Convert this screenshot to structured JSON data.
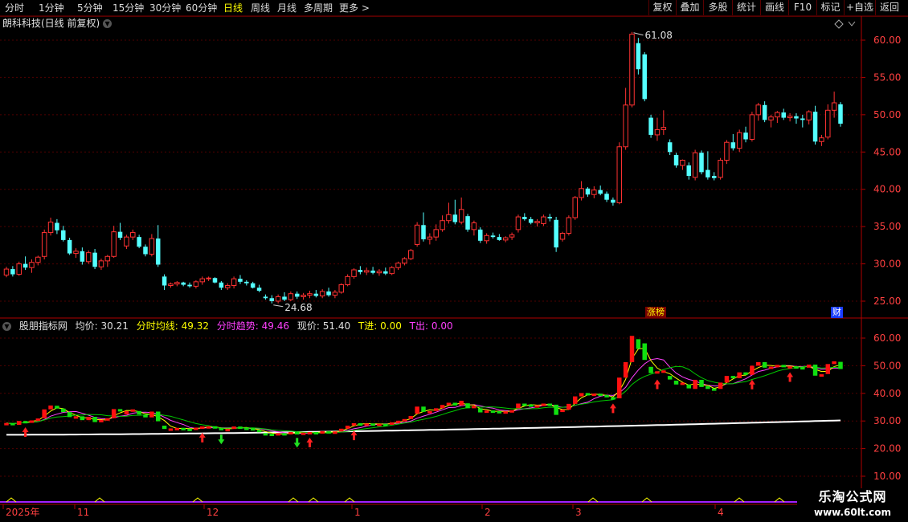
{
  "toolbar": {
    "periods": [
      "分时",
      "1分钟",
      "5分钟",
      "15分钟",
      "30分钟",
      "60分钟",
      "日线",
      "周线",
      "月线",
      "多周期",
      "更多 >"
    ],
    "active_period": "日线",
    "right_buttons": [
      "复权",
      "叠加",
      "多股",
      "统计",
      "画线",
      "F10",
      "标记",
      "+自选",
      "返回"
    ]
  },
  "main_chart": {
    "title": "朗科科技(日线 前复权)",
    "y_ticks": [
      "60.00",
      "55.00",
      "50.00",
      "45.00",
      "40.00",
      "35.00",
      "30.00",
      "25.00"
    ],
    "high_label": "61.08",
    "low_label": "24.68",
    "tags": [
      "涨榜",
      "财"
    ],
    "colors": {
      "up": "#ff3232",
      "down": "#54ffff",
      "axis": "#b00000",
      "grid": "#500000"
    }
  },
  "indicator": {
    "name": "股朋指标网",
    "fields": [
      {
        "label": "均价:",
        "value": "30.21",
        "color": "#e0e0e0"
      },
      {
        "label": "分时均线:",
        "value": "49.32",
        "color": "#ffff00"
      },
      {
        "label": "分时趋势:",
        "value": "49.46",
        "color": "#ff40ff"
      },
      {
        "label": "现价:",
        "value": "51.40",
        "color": "#e0e0e0"
      },
      {
        "label": "T进:",
        "value": "0.00",
        "color": "#ffff00"
      },
      {
        "label": "T出:",
        "value": "0.00",
        "color": "#ff40ff"
      }
    ],
    "y_ticks": [
      "60.00",
      "50.00",
      "40.00",
      "30.00",
      "20.00",
      "10.00"
    ]
  },
  "x_axis": {
    "labels": [
      "2025年",
      "11",
      "12",
      "1",
      "2",
      "3",
      "4"
    ]
  },
  "watermark": {
    "name": "乐淘公式网",
    "url": "www.60lt.com"
  },
  "chart_data": {
    "type": "candlestick",
    "candles": [
      [
        28.5,
        29.6,
        28.2,
        29.3
      ],
      [
        29.3,
        29.7,
        28.3,
        28.6
      ],
      [
        28.6,
        30.3,
        28.4,
        30.0
      ],
      [
        30.0,
        31.0,
        29.2,
        29.5
      ],
      [
        29.5,
        30.6,
        28.8,
        30.2
      ],
      [
        30.2,
        31.1,
        29.8,
        30.9
      ],
      [
        31.0,
        34.6,
        30.6,
        34.2
      ],
      [
        34.2,
        36.2,
        33.8,
        35.6
      ],
      [
        35.5,
        36.0,
        34.0,
        34.5
      ],
      [
        34.5,
        35.1,
        33.0,
        33.2
      ],
      [
        33.2,
        33.5,
        31.2,
        31.4
      ],
      [
        31.4,
        32.1,
        30.8,
        31.7
      ],
      [
        31.7,
        32.2,
        29.9,
        30.3
      ],
      [
        30.3,
        31.8,
        30.0,
        31.5
      ],
      [
        31.5,
        32.0,
        29.3,
        29.6
      ],
      [
        29.6,
        30.7,
        29.2,
        30.4
      ],
      [
        30.4,
        31.2,
        29.6,
        31.0
      ],
      [
        31.0,
        35.1,
        30.8,
        34.3
      ],
      [
        34.3,
        35.5,
        33.2,
        33.5
      ],
      [
        32.4,
        33.9,
        32.0,
        33.6
      ],
      [
        33.6,
        34.6,
        33.2,
        34.2
      ],
      [
        33.6,
        33.9,
        32.1,
        32.3
      ],
      [
        32.3,
        32.6,
        31.0,
        31.3
      ],
      [
        31.3,
        34.0,
        31.0,
        33.4
      ],
      [
        33.4,
        35.2,
        29.6,
        29.9
      ],
      [
        28.3,
        28.6,
        26.5,
        27.1
      ],
      [
        27.1,
        27.5,
        26.8,
        27.3
      ],
      [
        27.3,
        27.7,
        27.0,
        27.5
      ],
      [
        27.5,
        27.6,
        27.0,
        27.2
      ],
      [
        27.2,
        27.5,
        26.8,
        27.0
      ],
      [
        27.0,
        27.8,
        26.7,
        27.6
      ],
      [
        27.6,
        28.3,
        27.2,
        28.0
      ],
      [
        28.0,
        28.3,
        27.7,
        28.1
      ],
      [
        28.1,
        28.2,
        27.4,
        27.5
      ],
      [
        27.5,
        27.7,
        26.5,
        26.8
      ],
      [
        26.8,
        27.4,
        26.5,
        27.1
      ],
      [
        27.1,
        28.3,
        26.7,
        28.0
      ],
      [
        28.0,
        28.5,
        27.3,
        27.6
      ],
      [
        27.6,
        27.8,
        27.1,
        27.4
      ],
      [
        27.4,
        27.6,
        26.7,
        26.8
      ],
      [
        26.8,
        27.2,
        26.2,
        26.4
      ],
      [
        25.6,
        25.9,
        25.2,
        25.4
      ],
      [
        25.4,
        25.8,
        24.7,
        25.0
      ],
      [
        25.0,
        25.9,
        24.7,
        25.6
      ],
      [
        25.6,
        26.2,
        25.0,
        25.2
      ],
      [
        25.2,
        26.3,
        25.0,
        26.0
      ],
      [
        26.0,
        26.3,
        25.3,
        25.6
      ],
      [
        25.6,
        26.1,
        25.2,
        25.8
      ],
      [
        25.8,
        26.4,
        25.4,
        26.0
      ],
      [
        26.0,
        26.5,
        25.5,
        25.7
      ],
      [
        25.7,
        26.6,
        25.4,
        26.3
      ],
      [
        26.3,
        26.8,
        25.6,
        25.8
      ],
      [
        25.8,
        26.5,
        25.4,
        26.2
      ],
      [
        26.2,
        27.4,
        26.0,
        27.2
      ],
      [
        27.2,
        28.6,
        27.0,
        28.3
      ],
      [
        28.3,
        29.4,
        28.0,
        29.2
      ],
      [
        29.2,
        29.7,
        28.6,
        28.9
      ],
      [
        28.9,
        29.5,
        28.5,
        29.1
      ],
      [
        29.1,
        29.6,
        28.6,
        28.8
      ],
      [
        28.8,
        29.3,
        28.4,
        29.0
      ],
      [
        29.0,
        29.5,
        28.5,
        28.7
      ],
      [
        28.7,
        29.7,
        28.5,
        29.5
      ],
      [
        29.5,
        30.3,
        29.2,
        30.1
      ],
      [
        30.1,
        30.9,
        29.8,
        30.7
      ],
      [
        30.7,
        32.0,
        30.5,
        31.8
      ],
      [
        32.6,
        35.6,
        32.3,
        35.2
      ],
      [
        35.2,
        36.9,
        33.0,
        33.3
      ],
      [
        33.3,
        34.1,
        32.6,
        33.6
      ],
      [
        33.6,
        35.3,
        33.1,
        34.6
      ],
      [
        34.6,
        36.5,
        34.3,
        35.8
      ],
      [
        35.8,
        38.2,
        35.4,
        36.6
      ],
      [
        36.6,
        38.6,
        35.3,
        35.6
      ],
      [
        35.6,
        38.9,
        35.3,
        37.3
      ],
      [
        36.4,
        36.7,
        34.3,
        34.6
      ],
      [
        34.6,
        35.8,
        33.8,
        35.5
      ],
      [
        34.6,
        34.9,
        32.8,
        33.1
      ],
      [
        33.1,
        34.1,
        32.7,
        33.8
      ],
      [
        33.8,
        34.2,
        33.4,
        33.6
      ],
      [
        33.6,
        34.0,
        33.1,
        33.2
      ],
      [
        33.2,
        33.7,
        32.9,
        33.5
      ],
      [
        33.6,
        34.2,
        33.2,
        33.9
      ],
      [
        34.6,
        36.6,
        34.2,
        36.3
      ],
      [
        36.3,
        36.8,
        35.8,
        36.0
      ],
      [
        36.0,
        36.3,
        35.3,
        35.5
      ],
      [
        35.5,
        36.0,
        35.0,
        35.7
      ],
      [
        35.4,
        36.6,
        35.1,
        36.3
      ],
      [
        36.3,
        36.7,
        35.7,
        36.1
      ],
      [
        35.9,
        36.3,
        31.6,
        32.2
      ],
      [
        33.3,
        34.3,
        33.0,
        34.1
      ],
      [
        34.1,
        36.5,
        33.8,
        36.2
      ],
      [
        36.2,
        39.1,
        35.9,
        38.9
      ],
      [
        38.9,
        41.1,
        38.5,
        40.1
      ],
      [
        40.1,
        40.3,
        39.0,
        39.3
      ],
      [
        39.3,
        40.4,
        38.8,
        39.9
      ],
      [
        39.9,
        40.5,
        39.2,
        39.4
      ],
      [
        39.4,
        39.7,
        38.3,
        38.6
      ],
      [
        38.6,
        38.9,
        37.8,
        38.2
      ],
      [
        38.2,
        46.3,
        38.0,
        45.7
      ],
      [
        45.7,
        53.6,
        45.3,
        51.3
      ],
      [
        51.3,
        61.1,
        51.0,
        60.8
      ],
      [
        59.6,
        60.3,
        55.4,
        56.1
      ],
      [
        58.1,
        58.4,
        51.8,
        52.1
      ],
      [
        49.6,
        50.0,
        46.9,
        47.3
      ],
      [
        47.3,
        49.6,
        46.5,
        48.0
      ],
      [
        48.0,
        50.6,
        47.3,
        48.3
      ],
      [
        46.3,
        46.7,
        44.6,
        45.0
      ],
      [
        44.6,
        44.9,
        42.9,
        43.2
      ],
      [
        43.2,
        44.0,
        42.6,
        43.9
      ],
      [
        43.2,
        43.6,
        41.3,
        41.8
      ],
      [
        41.6,
        45.3,
        41.2,
        44.9
      ],
      [
        44.9,
        45.2,
        42.0,
        42.3
      ],
      [
        42.6,
        45.1,
        41.3,
        41.6
      ],
      [
        41.8,
        42.3,
        41.2,
        41.5
      ],
      [
        41.6,
        44.2,
        41.3,
        43.9
      ],
      [
        43.9,
        46.6,
        43.4,
        46.3
      ],
      [
        46.3,
        47.4,
        45.2,
        45.5
      ],
      [
        45.5,
        48.0,
        45.0,
        47.6
      ],
      [
        47.6,
        48.4,
        46.3,
        46.7
      ],
      [
        46.7,
        50.4,
        46.4,
        50.0
      ],
      [
        50.0,
        51.6,
        49.2,
        51.3
      ],
      [
        51.3,
        51.8,
        49.0,
        49.3
      ],
      [
        49.3,
        50.0,
        48.3,
        49.7
      ],
      [
        49.7,
        50.5,
        48.9,
        50.3
      ],
      [
        50.3,
        50.8,
        49.3,
        49.6
      ],
      [
        49.6,
        50.2,
        49.1,
        49.8
      ],
      [
        49.8,
        50.2,
        48.8,
        49.5
      ],
      [
        49.5,
        50.0,
        48.3,
        49.3
      ],
      [
        49.3,
        50.6,
        48.7,
        50.4
      ],
      [
        50.4,
        51.2,
        46.0,
        46.4
      ],
      [
        46.4,
        47.3,
        45.8,
        46.9
      ],
      [
        47.0,
        51.4,
        46.7,
        50.6
      ],
      [
        50.6,
        53.1,
        49.6,
        51.6
      ],
      [
        51.4,
        51.7,
        48.4,
        48.8
      ]
    ],
    "avg_price": 30.21,
    "high": 61.08,
    "low": 24.68,
    "last_close": 51.4
  }
}
